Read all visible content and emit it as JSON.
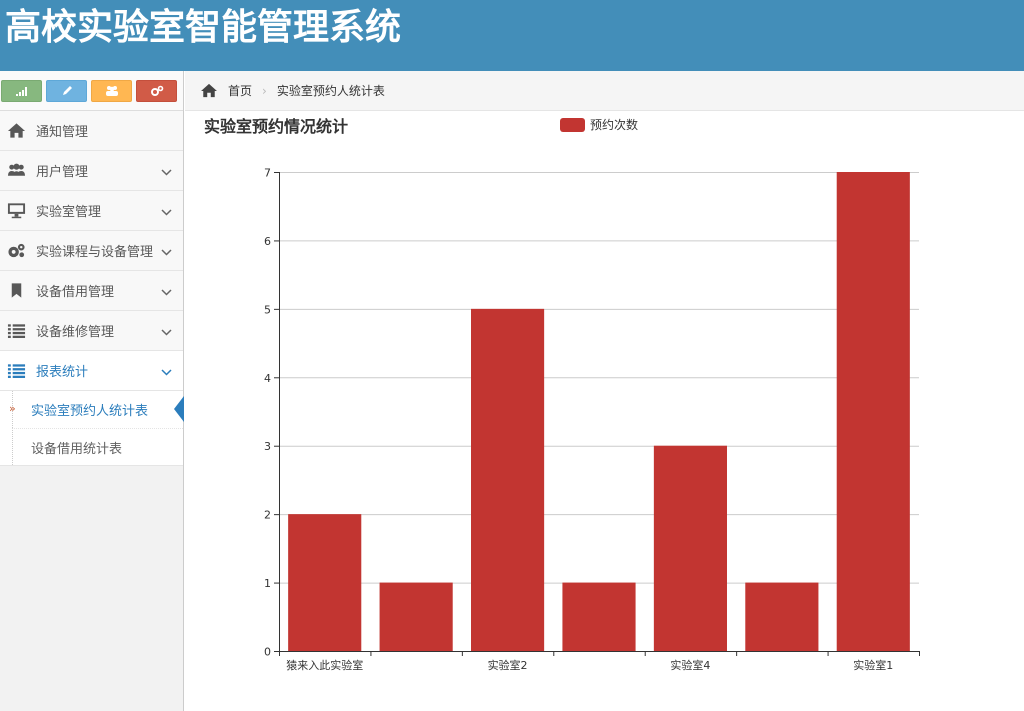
{
  "app": {
    "title": "高校实验室智能管理系统"
  },
  "shortcuts": [
    {
      "name": "signal",
      "color": "#87b87f"
    },
    {
      "name": "pencil",
      "color": "#6fb3e0"
    },
    {
      "name": "users",
      "color": "#ffb752"
    },
    {
      "name": "cogs",
      "color": "#d15b47"
    }
  ],
  "sidebar": {
    "items": [
      {
        "label": "通知管理",
        "icon": "home-icon"
      },
      {
        "label": "用户管理",
        "icon": "users-icon"
      },
      {
        "label": "实验室管理",
        "icon": "desktop-icon"
      },
      {
        "label": "实验课程与设备管理",
        "icon": "cogs-icon"
      },
      {
        "label": "设备借用管理",
        "icon": "bookmark-icon"
      },
      {
        "label": "设备维修管理",
        "icon": "list-icon"
      },
      {
        "label": "报表统计",
        "icon": "list-icon"
      }
    ],
    "subitems": [
      {
        "label": "实验室预约人统计表",
        "active": true
      },
      {
        "label": "设备借用统计表",
        "active": false
      }
    ]
  },
  "breadcrumb": {
    "home": "首页",
    "current": "实验室预约人统计表"
  },
  "chart_data": {
    "type": "bar",
    "title": "实验室预约情况统计",
    "legend": [
      "预约次数"
    ],
    "legend_placement": "top-center",
    "categories": [
      "猿来入此实验室",
      "",
      "实验室2",
      "",
      "实验室4",
      "",
      "实验室1"
    ],
    "series": [
      {
        "name": "预约次数",
        "values": [
          2,
          1,
          5,
          1,
          3,
          1,
          7
        ]
      }
    ],
    "ylim": [
      0,
      7
    ],
    "yticks": [
      0,
      1,
      2,
      3,
      4,
      5,
      6,
      7
    ],
    "grid": true,
    "color": "#c23531"
  }
}
